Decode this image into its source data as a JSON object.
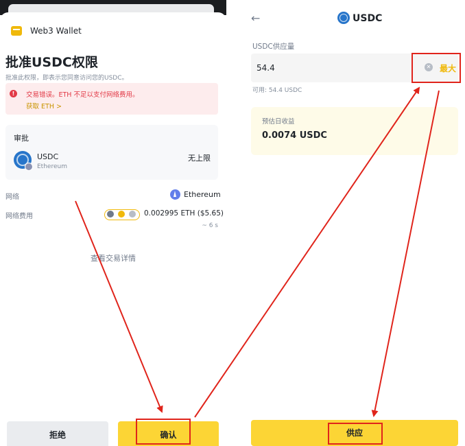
{
  "left_panel": {
    "wallet_name": "Web3 Wallet",
    "title": "批准USDC权限",
    "subtitle": "批准此权限，即表示您同意访问您的USDC。",
    "error": {
      "icon": "error-icon",
      "message": "交易错误。ETH 不足以支付网络费用。",
      "link": "获取 ETH >"
    },
    "approval": {
      "label": "审批",
      "token": "USDC",
      "chain": "Ethereum",
      "limit": "无上限"
    },
    "network": {
      "label": "网络",
      "value": "Ethereum"
    },
    "fee": {
      "label": "网络费用",
      "value": "0.002995 ETH ($5.65)",
      "time": "~ 6 s"
    },
    "details_link": "查看交易详情",
    "reject_label": "拒绝",
    "confirm_label": "确认"
  },
  "right_panel": {
    "title": "USDC",
    "supply_label": "USDC供应量",
    "supply_value": "54.4",
    "max_label": "最大",
    "available": "可用: 54.4 USDC",
    "daily_label": "预估日收益",
    "daily_value": "0.0074 USDC",
    "supply_button": "供应"
  },
  "colors": {
    "brand_yellow": "#fcd535",
    "error_red": "#e23a47",
    "annotation_red": "#e0241b",
    "usdc_blue": "#2775ca"
  }
}
